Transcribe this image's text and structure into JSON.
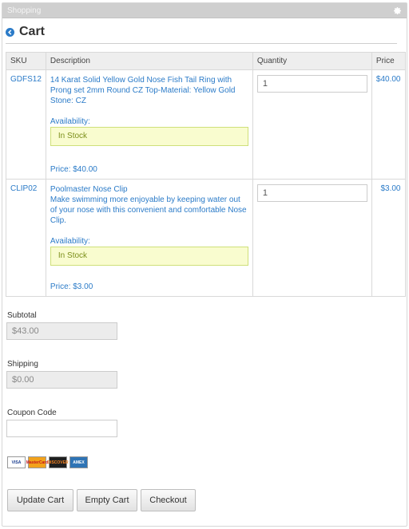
{
  "widget": {
    "title": "Shopping",
    "settings_icon": "gear-icon"
  },
  "heading": {
    "title": "Cart",
    "back_icon": "chevron-left-icon"
  },
  "table": {
    "headers": {
      "sku": "SKU",
      "description": "Description",
      "quantity": "Quantity",
      "price": "Price"
    },
    "rows": [
      {
        "sku": "GDFS12",
        "description": "14 Karat Solid Yellow Gold Nose Fish Tail Ring with Prong set 2mm Round CZ Top-Material: Yellow Gold Stone: CZ",
        "availability_label": "Availability:",
        "availability": "In Stock",
        "unit_price": "Price: $40.00",
        "quantity": "1",
        "price": "$40.00"
      },
      {
        "sku": "CLIP02",
        "description": "Poolmaster Nose Clip",
        "detail": "Make swimming more enjoyable by keeping water out of your nose with this convenient and comfortable Nose Clip.",
        "availability_label": "Availability:",
        "availability": "In Stock",
        "unit_price": "Price: $3.00",
        "quantity": "1",
        "price": "$3.00"
      }
    ]
  },
  "summary": {
    "subtotal_label": "Subtotal",
    "subtotal": "$43.00",
    "shipping_label": "Shipping",
    "shipping": "$0.00",
    "coupon_label": "Coupon Code",
    "coupon": ""
  },
  "cards": [
    {
      "icon": "visa-card-icon",
      "label": "VISA"
    },
    {
      "icon": "mastercard-icon",
      "label": "MasterCard"
    },
    {
      "icon": "discover-card-icon",
      "label": "DISCOVER"
    },
    {
      "icon": "amex-card-icon",
      "label": "AMEX"
    }
  ],
  "buttons": {
    "update": "Update Cart",
    "empty": "Empty Cart",
    "checkout": "Checkout"
  },
  "colors": {
    "link": "#2b7bc8",
    "stock_bg": "#f9fccf",
    "stock_border": "#cfe07a",
    "titlebar": "#cfcfcf"
  }
}
